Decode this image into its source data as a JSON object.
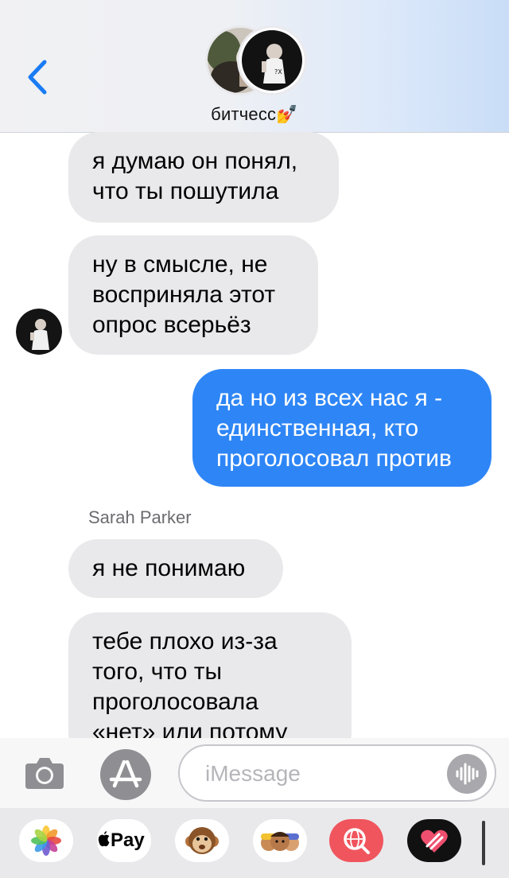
{
  "header": {
    "group_name": "битчесс💅",
    "back_icon": "chevron-left-icon"
  },
  "thread": {
    "messages": [
      {
        "direction": "incoming",
        "text": "я думаю он понял,\nчто ты пошутила"
      },
      {
        "direction": "incoming",
        "text": "ну в смысле, не\nвосприняла этот\nопрос всерьёз"
      },
      {
        "direction": "outgoing",
        "text": "да но из всех нас я -\nединственная, кто\nпроголосовал против"
      },
      {
        "direction": "incoming",
        "sender": "Sarah Parker",
        "text": "я не понимаю"
      },
      {
        "direction": "incoming",
        "text": "тебе плохо из-за\nтого, что ты\nпроголосовала\n«нет» или потому"
      }
    ]
  },
  "input": {
    "placeholder": "iMessage",
    "value": "",
    "camera_icon": "camera-icon",
    "appstore_icon": "app-store-icon",
    "audio_icon": "audio-waveform-icon"
  },
  "drawer": {
    "apps": [
      {
        "name": "photos-app-icon"
      },
      {
        "name": "apple-pay-app-icon",
        "label": "Pay"
      },
      {
        "name": "animoji-monkey-icon"
      },
      {
        "name": "memoji-stickers-icon"
      },
      {
        "name": "web-images-search-icon"
      },
      {
        "name": "digital-touch-heart-icon"
      }
    ]
  },
  "colors": {
    "outgoing_bubble": "#2e86f6",
    "incoming_bubble": "#e9e9eb",
    "ios_blue": "#1a7cf4"
  }
}
